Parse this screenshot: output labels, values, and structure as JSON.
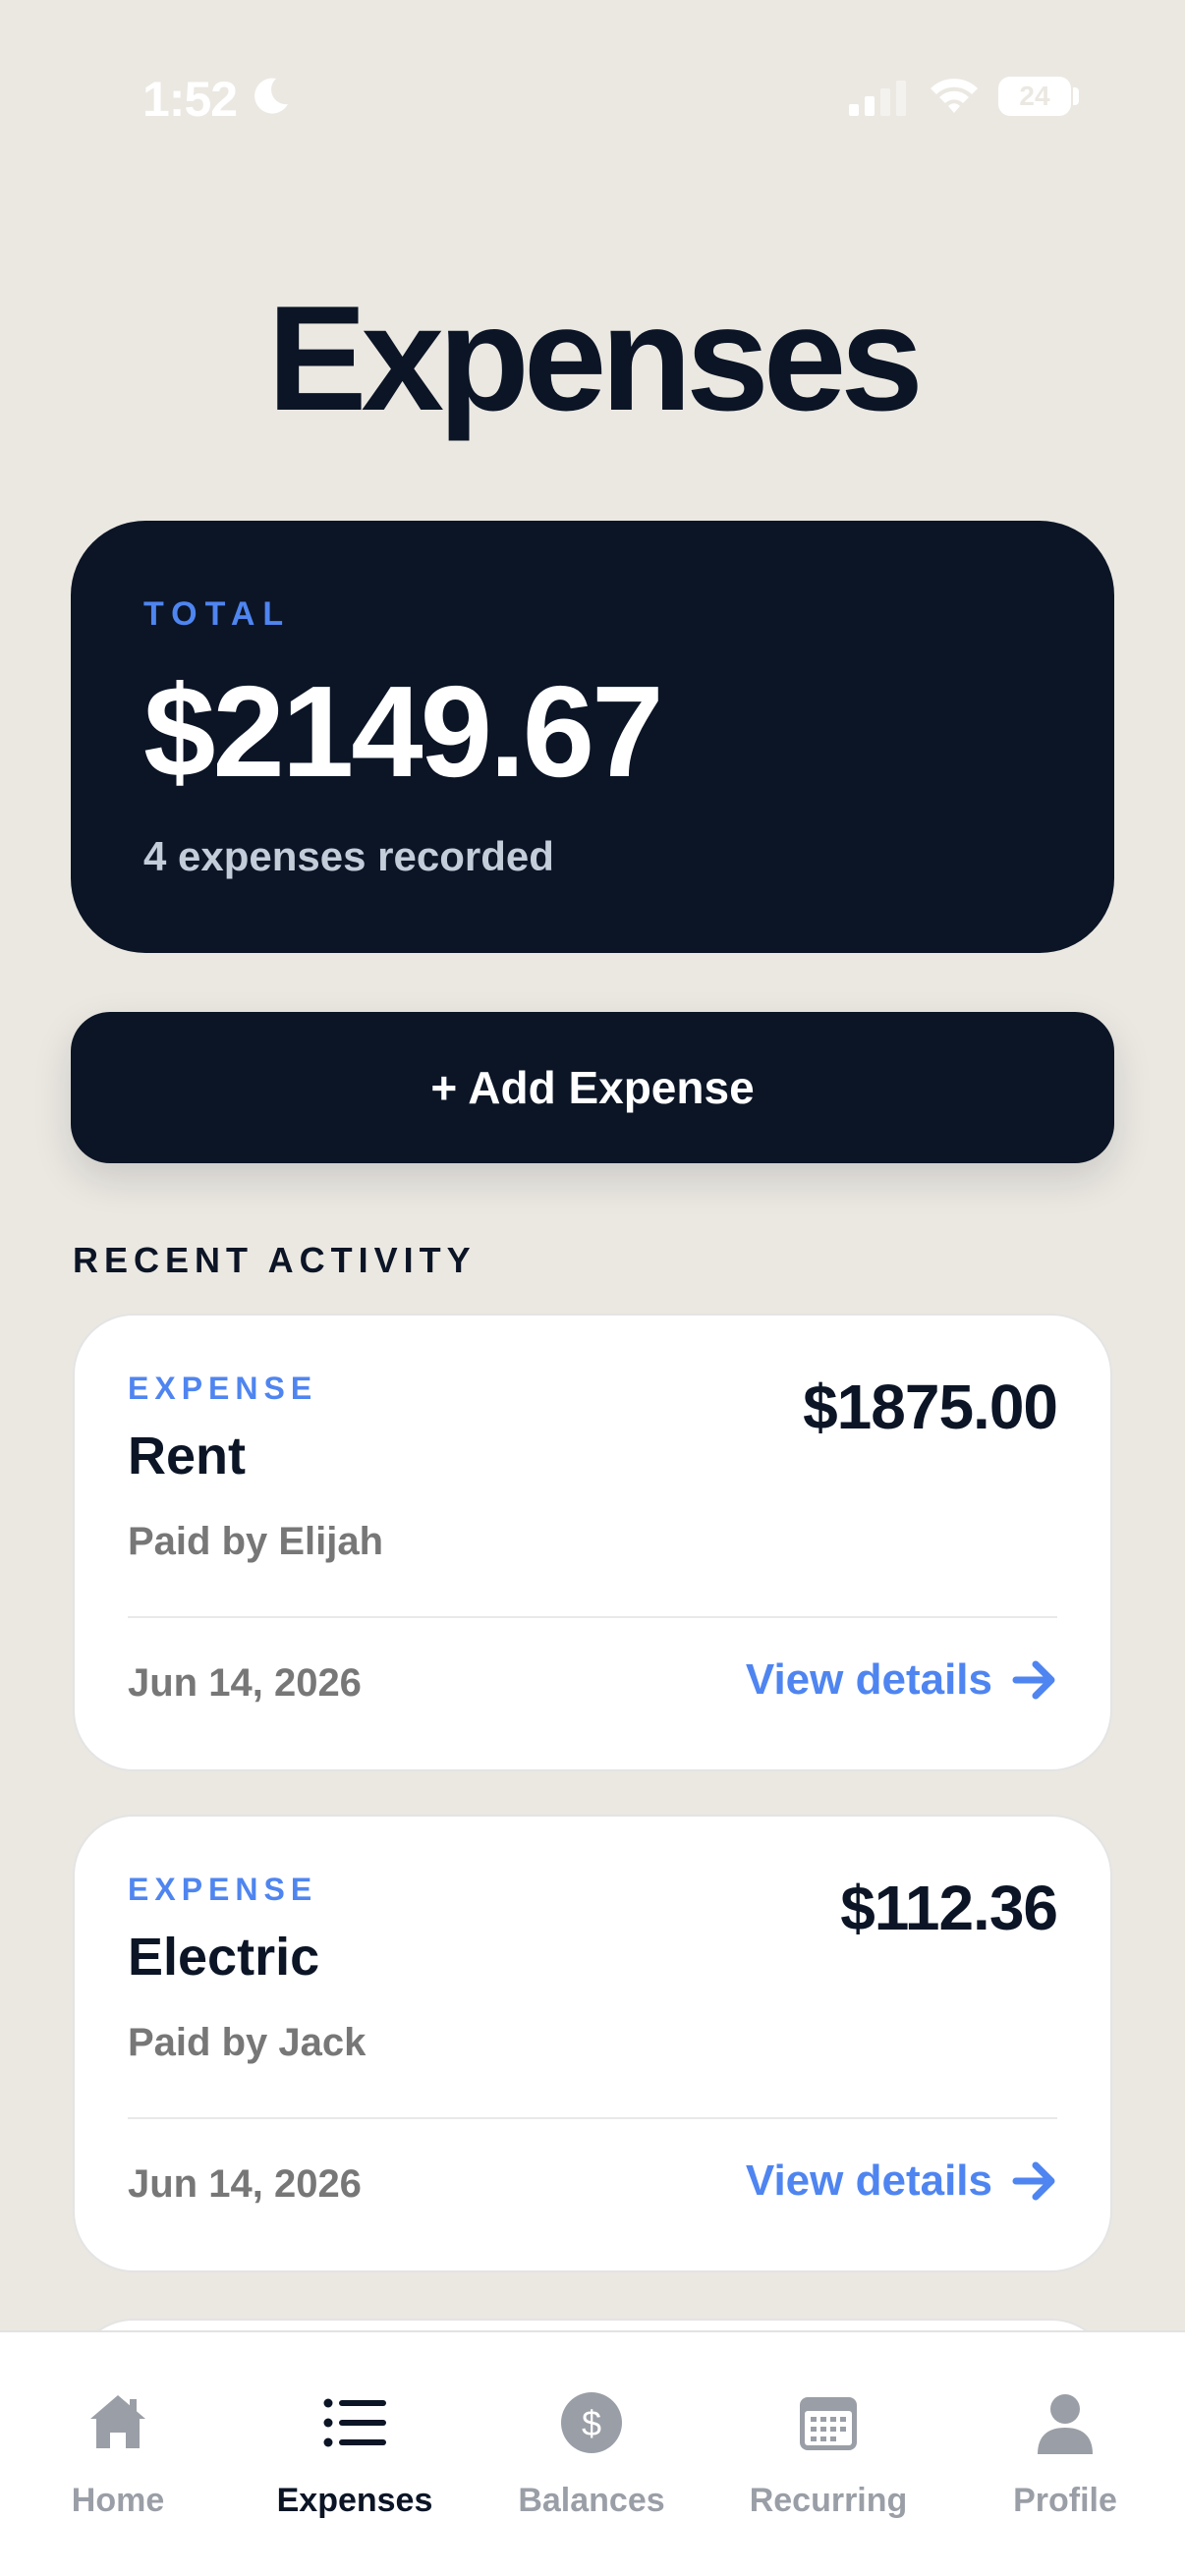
{
  "status_bar": {
    "time": "1:52",
    "battery": "24"
  },
  "header": {
    "title": "Expenses"
  },
  "summary": {
    "label": "TOTAL",
    "amount": "$2149.67",
    "subtitle": "4 expenses recorded"
  },
  "actions": {
    "add_label": "+ Add Expense"
  },
  "recent": {
    "heading": "RECENT ACTIVITY",
    "items": [
      {
        "type": "EXPENSE",
        "title": "Rent",
        "amount": "$1875.00",
        "payer": "Paid by Elijah",
        "date": "Jun 14, 2026",
        "link": "View details"
      },
      {
        "type": "EXPENSE",
        "title": "Electric",
        "amount": "$112.36",
        "payer": "Paid by Jack",
        "date": "Jun 14, 2026",
        "link": "View details"
      }
    ]
  },
  "tabs": [
    {
      "label": "Home",
      "icon": "house-icon",
      "active": false
    },
    {
      "label": "Expenses",
      "icon": "list-icon",
      "active": true
    },
    {
      "label": "Balances",
      "icon": "dollar-circle-icon",
      "active": false
    },
    {
      "label": "Recurring",
      "icon": "calendar-icon",
      "active": false
    },
    {
      "label": "Profile",
      "icon": "person-icon",
      "active": false
    }
  ],
  "colors": {
    "background": "#EBE8E2",
    "navy": "#0B1526",
    "accent": "#4F85F0",
    "muted": "#777777",
    "inactive_tab": "#9A9EA6"
  }
}
